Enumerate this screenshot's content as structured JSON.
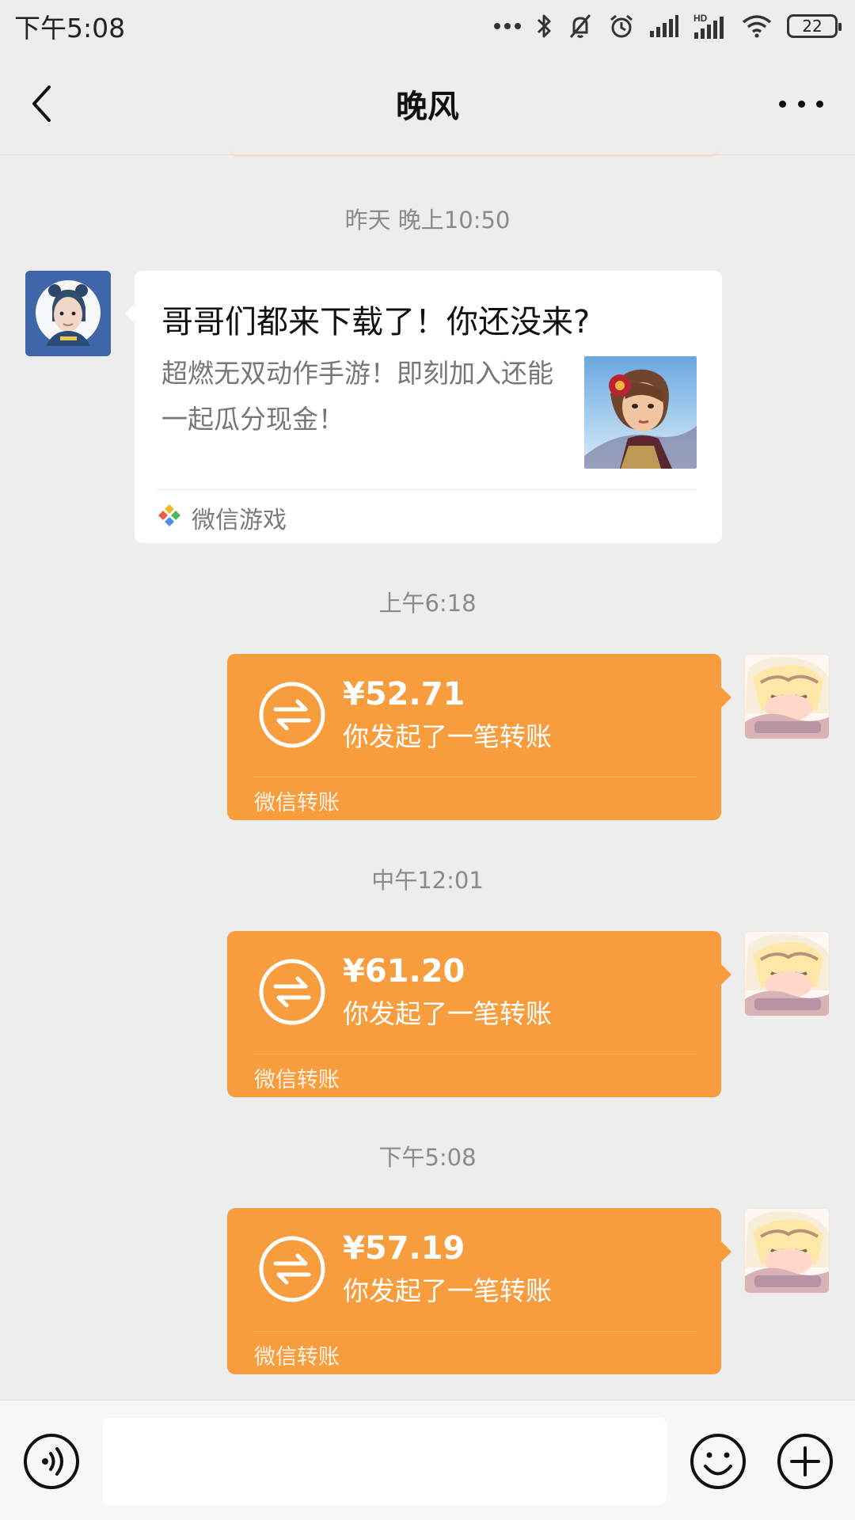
{
  "status_bar": {
    "time": "下午5:08",
    "battery": "22",
    "signal_label": "HD",
    "icons": [
      "more-dots-icon",
      "bluetooth-icon",
      "silent-bell-icon",
      "alarm-icon",
      "signal-icon",
      "hd-signal-icon",
      "wifi-icon",
      "battery-icon"
    ]
  },
  "header": {
    "title": "晚风",
    "back_icon": "chevron-left-icon",
    "more_icon": "more-horizontal-icon"
  },
  "messages": {
    "timestamps": [
      "昨天 晚上10:50",
      "上午6:18",
      "中午12:01",
      "下午5:08"
    ],
    "link_card": {
      "title": "哥哥们都来下载了！你还没来?",
      "description": "超燃无双动作手游！即刻加入还能一起瓜分现金！",
      "source": "微信游戏",
      "thumbnail": "game-character-image"
    },
    "transfers": [
      {
        "amount": "¥52.71",
        "status": "你发起了一笔转账",
        "source": "微信转账"
      },
      {
        "amount": "¥61.20",
        "status": "你发起了一笔转账",
        "source": "微信转账"
      },
      {
        "amount": "¥57.19",
        "status": "你发起了一笔转账",
        "source": "微信转账"
      }
    ]
  },
  "input_bar": {
    "voice_icon": "voice-icon",
    "emoji_icon": "emoji-icon",
    "plus_icon": "plus-icon",
    "input_value": ""
  },
  "colors": {
    "background": "#ededed",
    "transfer": "#f89d3d",
    "card": "#ffffff",
    "timestamp": "#8a8a8a"
  }
}
